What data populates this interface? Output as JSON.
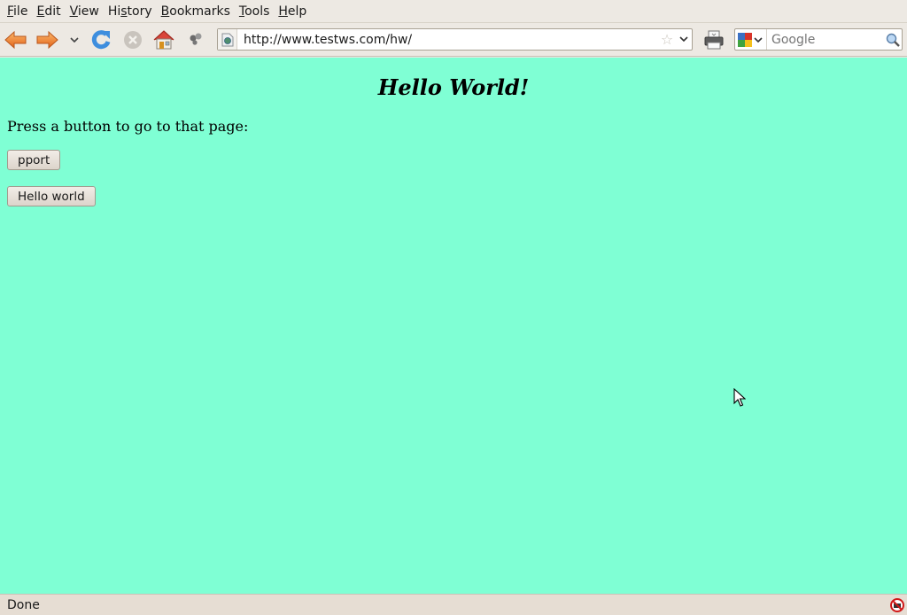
{
  "menubar": {
    "items": [
      {
        "label": "File",
        "mnemonic": "F",
        "rest": "ile"
      },
      {
        "label": "Edit",
        "mnemonic": "E",
        "rest": "dit"
      },
      {
        "label": "View",
        "mnemonic": "V",
        "rest": "iew"
      },
      {
        "label": "History",
        "pre": "Hi",
        "mnemonic": "s",
        "rest": "tory"
      },
      {
        "label": "Bookmarks",
        "mnemonic": "B",
        "rest": "ookmarks"
      },
      {
        "label": "Tools",
        "mnemonic": "T",
        "rest": "ools"
      },
      {
        "label": "Help",
        "mnemonic": "H",
        "rest": "elp"
      }
    ]
  },
  "navbar": {
    "url": "http://www.testws.com/hw/",
    "search_placeholder": "Google"
  },
  "colors": {
    "page_background": "#7fffd4",
    "chrome_background": "#ede9e3"
  },
  "page": {
    "heading": "Hello World!",
    "prompt": "Press a button to go to that page:",
    "buttons": [
      "pport",
      "Hello world"
    ]
  },
  "statusbar": {
    "text": "Done"
  }
}
